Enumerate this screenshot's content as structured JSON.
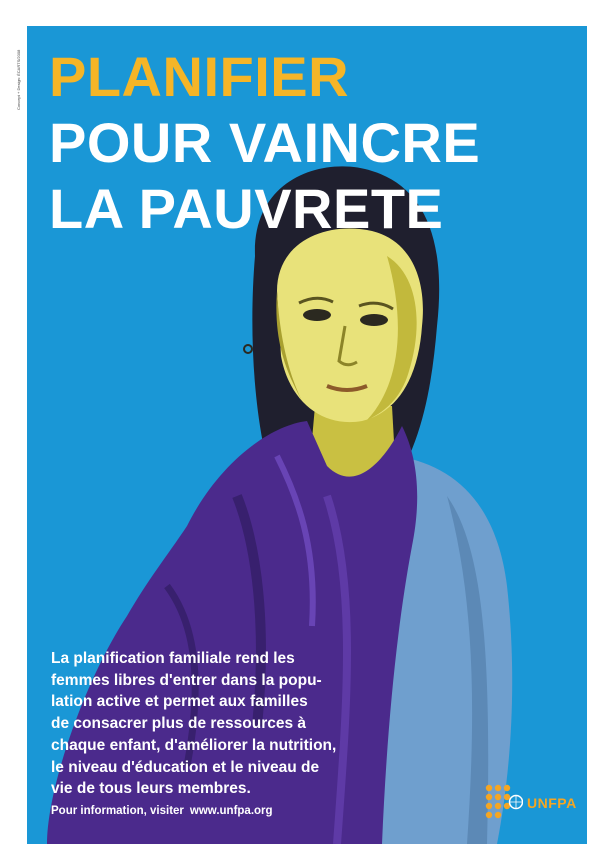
{
  "credit": "Concept + Design: ÉCARTS/2008",
  "headline": {
    "line1": "PLANIFIER",
    "line2": "POUR VAINCRE",
    "line3": "LA PAUVRETE"
  },
  "body_text": "La planification familiale rend les\nfemmes libres d'entrer dans la popu-\nlation active et permet aux familles\nde consacrer plus de ressources à\nchaque enfant, d'améliorer la nutrition,\nle niveau d'éducation et le niveau de\nvie de tous leurs membres.",
  "info": {
    "label": "Pour information, visiter",
    "url": "www.unfpa.org"
  },
  "logo": {
    "wordmark": "UNFPA",
    "icon": "unfpa-people-dots-emblem"
  },
  "colors": {
    "background": "#1a97d6",
    "headline_accent": "#f5b527",
    "headline_main": "#ffffff",
    "scarf": "#4b2a8c",
    "shirt": "#6f9fce",
    "logo": "#f5a623"
  }
}
